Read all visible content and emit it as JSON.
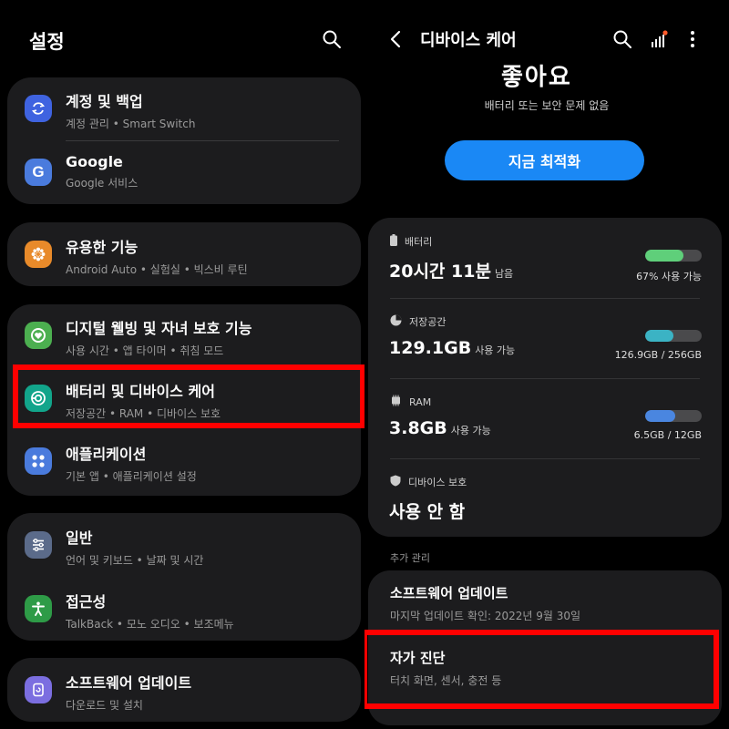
{
  "left": {
    "title": "설정",
    "groups": [
      {
        "items": [
          {
            "title": "계정 및 백업",
            "subtitle": "계정 관리 • Smart Switch",
            "icon": "sync-icon",
            "color": "#3f63e0"
          },
          {
            "title": "Google",
            "subtitle": "Google 서비스",
            "icon": "google-icon",
            "color": "#4a7bdd"
          }
        ]
      },
      {
        "items": [
          {
            "title": "유용한 기능",
            "subtitle": "Android Auto • 실험실 • 빅스비 루틴",
            "icon": "puzzle-icon",
            "color": "#e88a2a"
          }
        ]
      },
      {
        "items": [
          {
            "title": "디지털 웰빙 및 자녀 보호 기능",
            "subtitle": "사용 시간 • 앱 타이머 • 취침 모드",
            "icon": "wellbeing-icon",
            "color": "#4caf50"
          },
          {
            "title": "배터리 및 디바이스 케어",
            "subtitle": "저장공간 • RAM • 디바이스 보호",
            "icon": "device-care-icon",
            "color": "#12a58b"
          },
          {
            "title": "애플리케이션",
            "subtitle": "기본 앱 • 애플리케이션 설정",
            "icon": "apps-icon",
            "color": "#4a7bdd"
          }
        ]
      },
      {
        "items": [
          {
            "title": "일반",
            "subtitle": "언어 및 키보드 • 날짜 및 시간",
            "icon": "sliders-icon",
            "color": "#5b6b8a"
          },
          {
            "title": "접근성",
            "subtitle": "TalkBack • 모노 오디오 • 보조메뉴",
            "icon": "accessibility-icon",
            "color": "#2e9b47"
          }
        ]
      },
      {
        "items": [
          {
            "title": "소프트웨어 업데이트",
            "subtitle": "다운로드 및 설치",
            "icon": "update-icon",
            "color": "#7b6ee0"
          }
        ]
      }
    ]
  },
  "right": {
    "title": "디바이스 케어",
    "status_title": "좋아요",
    "status_subtitle": "배터리 또는 보안 문제 없음",
    "optimize_button": "지금 최적화",
    "battery": {
      "label": "배터리",
      "value": "20시간 11분",
      "suffix": "남음",
      "percent": 67,
      "percent_text": "67% 사용 가능",
      "color": "#5fcf7a"
    },
    "storage": {
      "label": "저장공간",
      "value": "129.1GB",
      "suffix": "사용 가능",
      "percent": 50,
      "usage_text": "126.9GB / 256GB",
      "color": "#3bb3c4"
    },
    "ram": {
      "label": "RAM",
      "value": "3.8GB",
      "suffix": "사용 가능",
      "percent": 54,
      "usage_text": "6.5GB / 12GB",
      "color": "#4a86e0"
    },
    "protection": {
      "label": "디바이스 보호",
      "value": "사용 안 함"
    },
    "more_label": "추가 관리",
    "software_update": {
      "title": "소프트웨어 업데이트",
      "subtitle": "마지막 업데이트 확인: 2022년 9월 30일"
    },
    "diagnostics": {
      "title": "자가 진단",
      "subtitle": "터치 화면, 센서, 충전 등"
    }
  }
}
